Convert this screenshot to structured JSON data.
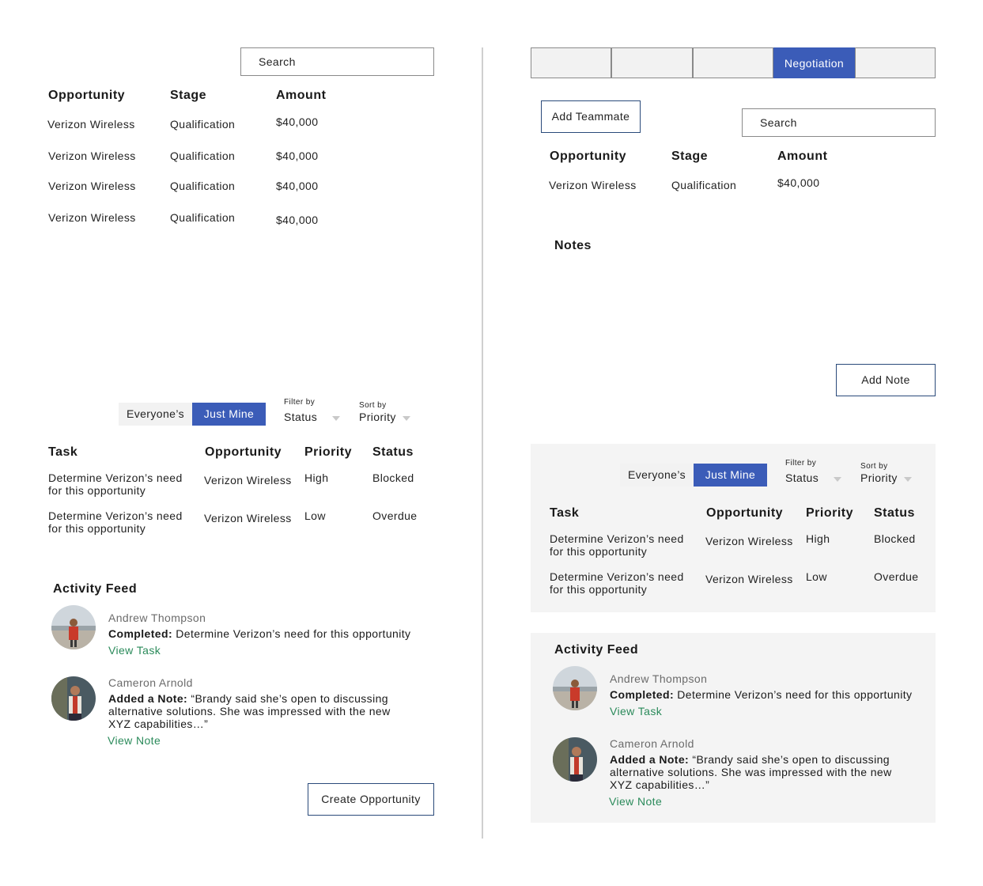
{
  "left": {
    "search": {
      "placeholder": "Search"
    },
    "opportunities": {
      "columns": [
        "Opportunity",
        "Stage",
        "Amount"
      ],
      "rows": [
        [
          "Verizon Wireless",
          "Qualification",
          "$40,000"
        ],
        [
          "Verizon Wireless",
          "Qualification",
          "$40,000"
        ],
        [
          "Verizon Wireless",
          "Qualification",
          "$40,000"
        ],
        [
          "Verizon Wireless",
          "Qualification",
          "$40,000"
        ]
      ]
    },
    "tasks_toolbar": {
      "everyone": "Everyone’s",
      "just_mine": "Just Mine",
      "filter_label": "Filter by",
      "filter_value": "Status",
      "sort_label": "Sort by",
      "sort_value": "Priority"
    },
    "tasks": {
      "columns": [
        "Task",
        "Opportunity",
        "Priority",
        "Status"
      ],
      "rows": [
        [
          "Determine Verizon’s need for this opportunity",
          "Verizon Wireless",
          "High",
          "Blocked"
        ],
        [
          "Determine Verizon’s need for this opportunity",
          "Verizon Wireless",
          "Low",
          "Overdue"
        ]
      ]
    },
    "activity_feed": {
      "title": "Activity Feed",
      "items": [
        {
          "name": "Andrew Thompson",
          "action": "Completed:",
          "text": " Determine Verizon’s need for this opportunity",
          "link": "View Task"
        },
        {
          "name": "Cameron Arnold",
          "action": "Added a Note:",
          "text": " “Brandy said she’s open to discussing alternative solutions. She was impressed with the new XYZ capabilities…”",
          "link": "View Note"
        }
      ]
    },
    "create_button": "Create Opportunity"
  },
  "right": {
    "stage_tabs": [
      "",
      "",
      "",
      "Negotiation",
      ""
    ],
    "active_tab": 3,
    "add_teammate": "Add Teammate",
    "search": {
      "placeholder": "Search"
    },
    "opportunity": {
      "columns": [
        "Opportunity",
        "Stage",
        "Amount"
      ],
      "row": [
        "Verizon Wireless",
        "Qualification",
        "$40,000"
      ]
    },
    "notes": {
      "title": "Notes",
      "add_button": "Add Note"
    },
    "tasks_toolbar": {
      "everyone": "Everyone’s",
      "just_mine": "Just Mine",
      "filter_label": "Filter by",
      "filter_value": "Status",
      "sort_label": "Sort by",
      "sort_value": "Priority"
    },
    "tasks": {
      "columns": [
        "Task",
        "Opportunity",
        "Priority",
        "Status"
      ],
      "rows": [
        [
          "Determine Verizon’s need for this opportunity",
          "Verizon Wireless",
          "High",
          "Blocked"
        ],
        [
          "Determine Verizon’s need for this opportunity",
          "Verizon Wireless",
          "Low",
          "Overdue"
        ]
      ]
    },
    "activity_feed": {
      "title": "Activity Feed",
      "items": [
        {
          "name": "Andrew Thompson",
          "action": "Completed:",
          "text": " Determine Verizon’s need for this opportunity",
          "link": "View Task"
        },
        {
          "name": "Cameron Arnold",
          "action": "Added a Note:",
          "text": " “Brandy said she’s open to discussing alternative solutions. She was impressed with the new XYZ capabilities…”",
          "link": "View Note"
        }
      ]
    }
  },
  "colors": {
    "accent": "#3b5cb8",
    "link": "#2a8a5a",
    "panel": "#f4f4f4",
    "border": "#2a4a7a"
  }
}
